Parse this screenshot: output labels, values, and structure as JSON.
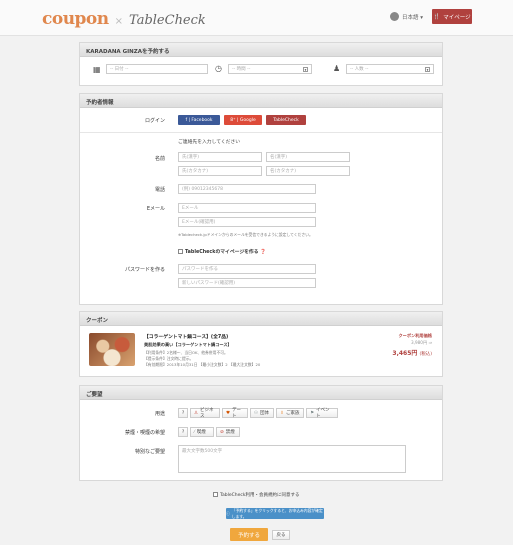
{
  "header": {
    "logo_coupon": "coupon",
    "logo_tablecheck": "TableCheck",
    "language": "日本語 ▾",
    "mypage": "マイページ"
  },
  "reserve": {
    "title": "KARADANA GINZAを予約する",
    "date_placeholder": "-- 日付 --",
    "time_placeholder": "-- 時間 --",
    "people_placeholder": "-- 人数 --"
  },
  "booker": {
    "title": "予約者情報",
    "login_label": "ログイン",
    "facebook": "f | Facebook",
    "google": "8⁺ | Google",
    "tablecheck": "TableCheck",
    "contact_note": "ご連絡先を入力してください",
    "name_label": "名前",
    "last_kanji": "氏(漢字)",
    "first_kanji": "名(漢字)",
    "last_kana": "氏(カタカナ)",
    "first_kana": "名(カタカナ)",
    "phone_label": "電話",
    "phone_placeholder": "(例) 09012345678",
    "email_label": "Eメール",
    "email_placeholder": "Eメール",
    "email_confirm_placeholder": "Eメール(確認用)",
    "email_note": "※Tablecheck.jpドメインからのメールを受信できるように設定してください。",
    "create_mypage": "TableCheckのマイページを作る",
    "password_label": "パスワードを作る",
    "password_placeholder": "パスワードを作る",
    "password_confirm_placeholder": "新しいパスワード(確認用)"
  },
  "coupon": {
    "title": "クーポン",
    "name": "【コラーゲントマト鍋コース】(全7品)",
    "subtitle": "美肌効果の高い【コラーゲントマト鍋コース】",
    "line1": "【利用条件】2名様～、当日OK、他券併用不可。",
    "line2": "【提示条件】注文時に提示。",
    "line3": "【有効期限】2013年10月31日 【最小注文数】2 【最大注文数】20",
    "price_label": "クーポン利用価格",
    "original_price": "3,980円 ⇒",
    "price": "3,465円",
    "tax": "(税込)"
  },
  "requests": {
    "title": "ご要望",
    "purpose_label": "用途",
    "purpose_options": [
      "?",
      "ビジネス",
      "デート",
      "団体",
      "ご家族",
      "イベント"
    ],
    "smoking_label": "禁煙・喫煙の希望",
    "smoking_options": [
      "?",
      "喫煙",
      "禁煙"
    ],
    "special_label": "特別なご要望",
    "special_placeholder": "最大文字数500文字"
  },
  "footer": {
    "agree": "TableCheck利用・会員規約に同意する",
    "info": "「予約する」をクリックすると、お申込み内容が確定します。",
    "submit": "予約する",
    "back": "戻る"
  },
  "colors": {
    "facebook": "#3b5998",
    "google": "#dd4b39",
    "tablecheck": "#b0413e",
    "submit": "#f0a73d",
    "info": "#4a90c8"
  }
}
